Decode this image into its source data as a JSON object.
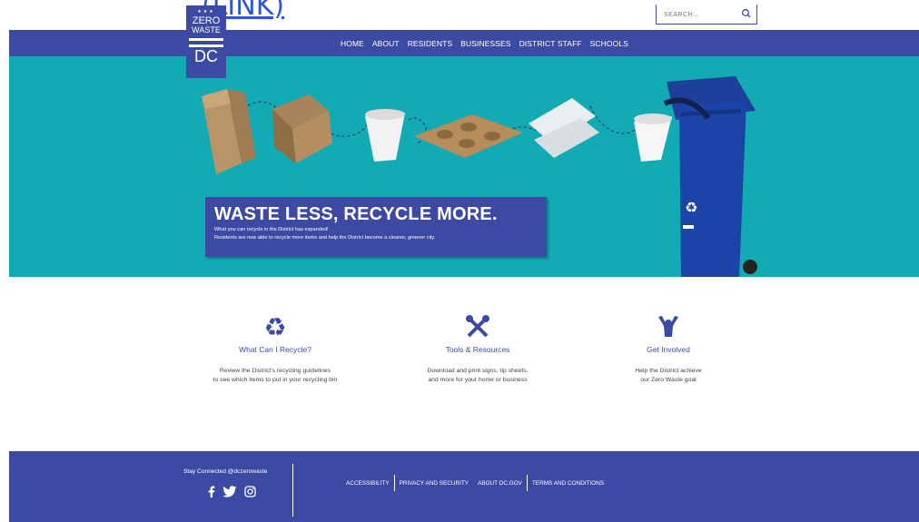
{
  "link_fragment": "(LINK)",
  "search": {
    "placeholder": "SEARCH..."
  },
  "logo": {
    "line1": "ZERO",
    "line2": "WASTE",
    "line3": "DC"
  },
  "nav": [
    {
      "label": "HOME"
    },
    {
      "label": "ABOUT"
    },
    {
      "label": "RESIDENTS"
    },
    {
      "label": "BUSINESSES"
    },
    {
      "label": "DISTRICT STAFF"
    },
    {
      "label": "SCHOOLS"
    }
  ],
  "hero": {
    "headline": "WASTE LESS, RECYCLE MORE.",
    "line1": "What you can recycle in the District has expanded!",
    "line2": "Residents are now able to recycle more items and help the District become a cleaner, greener city."
  },
  "cards": [
    {
      "icon": "recycle-icon",
      "title": "What Can I Recycle?",
      "desc1": "Review the District's recycling guidelines",
      "desc2": "to see which items to put in your recycling bin"
    },
    {
      "icon": "tools-icon",
      "title": "Tools & Resources",
      "desc1": "Download and print signs, tip sheets,",
      "desc2": "and more for your home or business"
    },
    {
      "icon": "person-icon",
      "title": "Get Involved",
      "desc1": "Help the District achieve",
      "desc2": "our Zero Waste goal"
    }
  ],
  "footer": {
    "stay": "Stay Connected @dczerowaste",
    "links": [
      {
        "label": "ACCESSIBILITY"
      },
      {
        "label": "PRIVACY AND SECURITY"
      },
      {
        "label": "ABOUT DC.GOV"
      },
      {
        "label": "TERMS AND CONDITIONS"
      }
    ]
  },
  "colors": {
    "brand": "#3d4aa3",
    "hero_bg": "#12aab3"
  }
}
